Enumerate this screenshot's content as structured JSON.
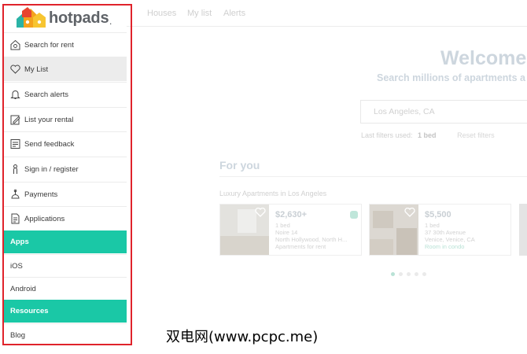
{
  "brand": {
    "name": "hotpads",
    "logo_icon": "hotpads-logo-icon"
  },
  "background": {
    "nav": [
      "Houses",
      "My list",
      "Alerts"
    ],
    "welcome": "Welcome",
    "subtitle": "Search millions of apartments a",
    "search_value": "Los Angeles, CA",
    "last_filters_label": "Last filters used:",
    "last_filters_value": "1 bed",
    "reset_filters": "Reset filters",
    "for_you": "For you",
    "section_title": "Luxury Apartments in Los Angeles",
    "cards": [
      {
        "price": "$2,630+",
        "beds": "1 bed",
        "name": "Noire 14",
        "area": "North Hollywood, North H...",
        "type": "Apartments for rent"
      },
      {
        "price": "$5,500",
        "beds": "1 bed",
        "name": "37 30th Avenue",
        "area": "Venice, Venice, CA",
        "type": "Room in condo"
      }
    ]
  },
  "menu": {
    "items": [
      {
        "label": "Search for rent",
        "icon": "house-search-icon"
      },
      {
        "label": "My List",
        "icon": "heart-icon"
      },
      {
        "label": "Search alerts",
        "icon": "bell-icon"
      },
      {
        "label": "List your rental",
        "icon": "edit-icon"
      },
      {
        "label": "Send feedback",
        "icon": "feedback-icon"
      },
      {
        "label": "Sign in / register",
        "icon": "user-icon"
      },
      {
        "label": "Payments",
        "icon": "payments-icon"
      },
      {
        "label": "Applications",
        "icon": "document-icon"
      }
    ],
    "apps_header": "Apps",
    "apps": [
      "iOS",
      "Android"
    ],
    "resources_header": "Resources",
    "resources": [
      "Blog"
    ]
  },
  "watermark": "双电网(www.pcpc.me)",
  "colors": {
    "accent": "#1ac8a6",
    "highlight_border": "#e0232b"
  }
}
